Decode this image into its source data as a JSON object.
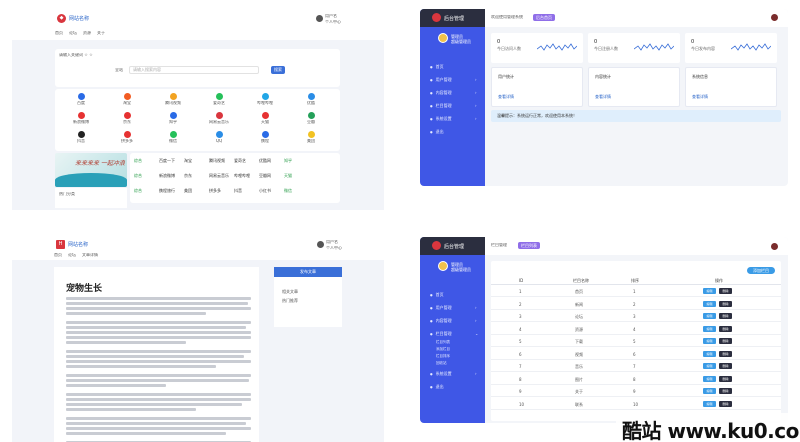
{
  "portal": {
    "logo_text": "网站名称",
    "user_lines": [
      "用户名",
      "个人中心"
    ],
    "nav": [
      "首页",
      "论坛",
      "资源",
      "关于"
    ],
    "search_hint": "请输入关键词 ☆ ☆",
    "search_category": "全站",
    "search_placeholder": "请输入搜索内容",
    "search_button": "搜索",
    "icons": [
      {
        "label": "百度",
        "color": "#2a6be6"
      },
      {
        "label": "淘宝",
        "color": "#f25c22"
      },
      {
        "label": "腾讯视频",
        "color": "#f2a322"
      },
      {
        "label": "爱奇艺",
        "color": "#25c05a"
      },
      {
        "label": "哔哩哔哩",
        "color": "#22a6e6"
      },
      {
        "label": "优酷",
        "color": "#2a8de6"
      },
      {
        "label": "新浪微博",
        "color": "#e63232"
      },
      {
        "label": "京东",
        "color": "#e63232"
      },
      {
        "label": "知乎",
        "color": "#2a6be6"
      },
      {
        "label": "网易云音乐",
        "color": "#d9363e"
      },
      {
        "label": "天猫",
        "color": "#e63232"
      },
      {
        "label": "豆瓣",
        "color": "#25a05a"
      },
      {
        "label": "抖音",
        "color": "#222222"
      },
      {
        "label": "拼多多",
        "color": "#e63232"
      },
      {
        "label": "微信",
        "color": "#25c05a"
      },
      {
        "label": "QQ",
        "color": "#2a8de6"
      },
      {
        "label": "携程",
        "color": "#2a6be6"
      },
      {
        "label": "美团",
        "color": "#f2c222"
      }
    ],
    "banner_text": "来来来来  一起冲浪",
    "category_title": "热门分类",
    "link_rows": [
      [
        "综合",
        "百度一下",
        "淘宝",
        "腾讯视频",
        "爱奇艺",
        "优酷网",
        "知乎"
      ],
      [
        "综合",
        "新浪微博",
        "京东",
        "网易云音乐",
        "哔哩哔哩",
        "豆瓣网",
        "天猫"
      ],
      [
        "综合",
        "携程旅行",
        "美团",
        "拼多多",
        "抖音",
        "小红书",
        "微信"
      ]
    ]
  },
  "dashboard": {
    "logo_text": "后台管理",
    "user_lines": [
      "管理员",
      "超级管理员"
    ],
    "menu": [
      "首页",
      "用户管理",
      "内容管理",
      "栏目管理",
      "系统设置",
      "退出"
    ],
    "header_title": "欢迎使用管理系统",
    "header_tag": "后台首页",
    "stats": [
      {
        "value": "0",
        "label": "今日访问人数"
      },
      {
        "value": "0",
        "label": "今日注册人数"
      },
      {
        "value": "0",
        "label": "今日发布内容"
      }
    ],
    "info_cards": [
      {
        "title": "用户统计",
        "link": "查看详情"
      },
      {
        "title": "内容统计",
        "link": "查看详情"
      },
      {
        "title": "系统信息",
        "link": "查看详情"
      }
    ],
    "alert": "温馨提示：系统运行正常，欢迎使用本系统！"
  },
  "article": {
    "logo_text": "网站名称",
    "user_lines": [
      "用户名",
      "个人中心"
    ],
    "breadcrumb": [
      "首页",
      "论坛",
      "文章详情"
    ],
    "title": "宠物生长",
    "post_button": "发布文章",
    "side_links": [
      "相关文章",
      "热门推荐"
    ]
  },
  "table": {
    "logo_text": "后台管理",
    "user_lines": [
      "管理员",
      "超级管理员"
    ],
    "menu": [
      "首页",
      "用户管理",
      "内容管理",
      "栏目管理",
      "系统设置",
      "退出"
    ],
    "submenu": [
      "栏目列表",
      "添加栏目",
      "栏目排序",
      "回收站"
    ],
    "header_title": "栏目管理",
    "header_tag": "栏目列表",
    "add_button": "添加栏目",
    "columns": [
      "ID",
      "栏目名称",
      "排序",
      "操作"
    ],
    "rows": [
      {
        "id": "1",
        "name": "首页",
        "sort": "1"
      },
      {
        "id": "2",
        "name": "新闻",
        "sort": "2"
      },
      {
        "id": "3",
        "name": "论坛",
        "sort": "3"
      },
      {
        "id": "4",
        "name": "资源",
        "sort": "4"
      },
      {
        "id": "5",
        "name": "下载",
        "sort": "5"
      },
      {
        "id": "6",
        "name": "视频",
        "sort": "6"
      },
      {
        "id": "7",
        "name": "音乐",
        "sort": "7"
      },
      {
        "id": "8",
        "name": "图片",
        "sort": "8"
      },
      {
        "id": "9",
        "name": "关于",
        "sort": "9"
      },
      {
        "id": "10",
        "name": "联系",
        "sort": "10"
      }
    ],
    "edit_label": "编辑",
    "delete_label": "删除"
  },
  "watermark": "酷站 www.ku0.com"
}
